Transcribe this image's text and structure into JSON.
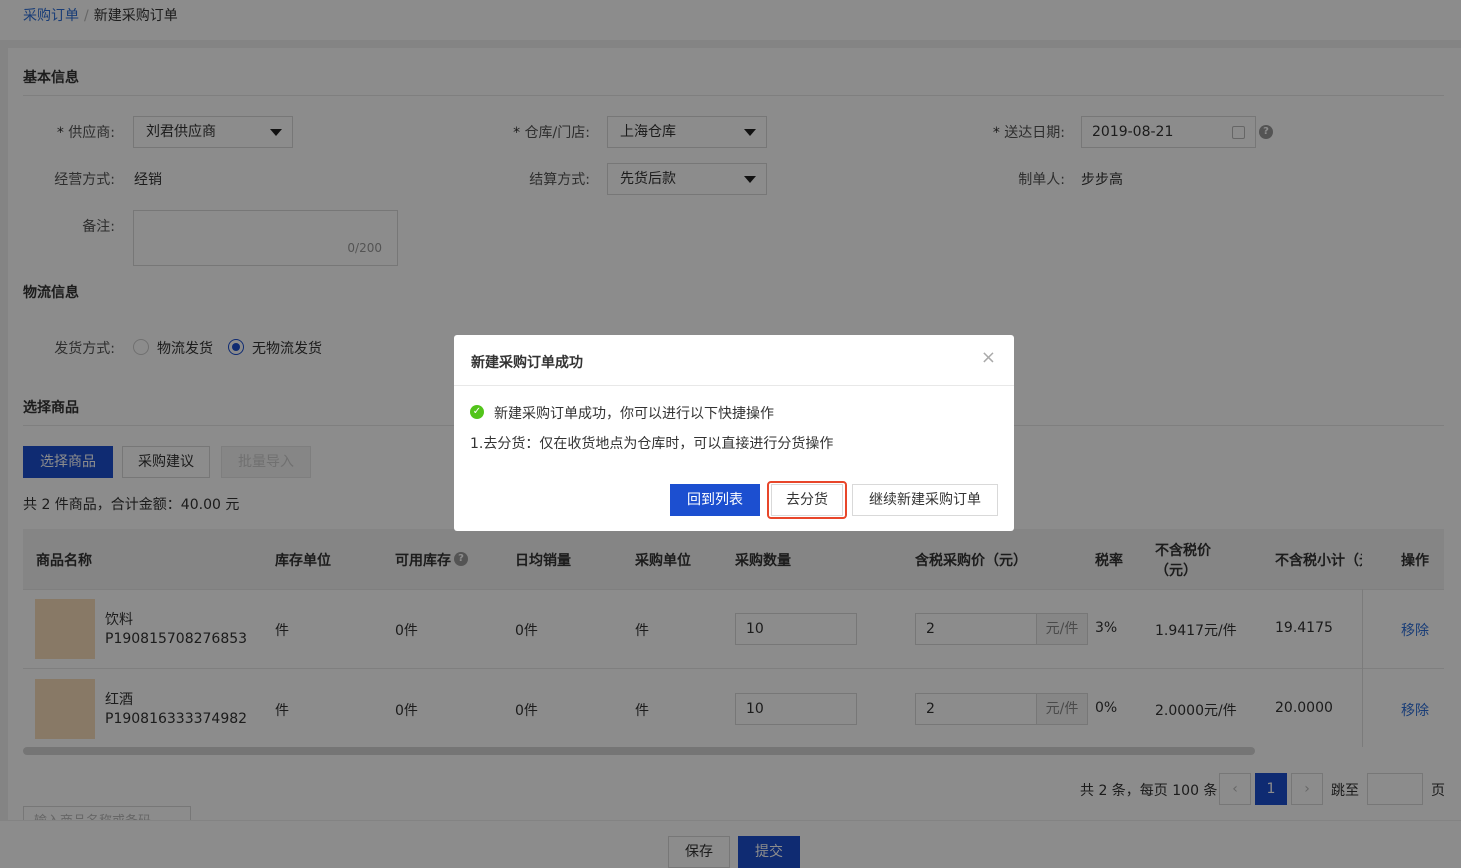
{
  "breadcrumb": {
    "parent": "采购订单",
    "sep": "/",
    "current": "新建采购订单"
  },
  "basic": {
    "title": "基本信息",
    "supplier_label": "供应商:",
    "supplier_value": "刘君供应商",
    "warehouse_label": "仓库/门店:",
    "warehouse_value": "上海仓库",
    "date_label": "送达日期:",
    "date_value": "2019-08-21",
    "business_label": "经营方式:",
    "business_value": "经销",
    "settle_label": "结算方式:",
    "settle_value": "先货后款",
    "maker_label": "制单人:",
    "maker_value": "步步高",
    "remark_label": "备注:",
    "remark_counter": "0/200"
  },
  "logistics": {
    "title": "物流信息",
    "ship_label": "发货方式:",
    "option1": "物流发货",
    "option2": "无物流发货",
    "selected": "无物流发货"
  },
  "goods": {
    "title": "选择商品",
    "btn_select": "选择商品",
    "btn_suggest": "采购建议",
    "btn_import": "批量导入",
    "summary": "共 2 件商品，合计金额：40.00 元",
    "columns": [
      "商品名称",
      "库存单位",
      "可用库存",
      "日均销量",
      "采购单位",
      "采购数量",
      "含税采购价（元）",
      "税率",
      "不含税价",
      "（元）",
      "不含税小计（元",
      "操作"
    ],
    "rows": [
      {
        "name": "饮料",
        "code": "P190815708276853",
        "stock_unit": "件",
        "available": "0件",
        "daily": "0件",
        "purchase_unit": "件",
        "qty": "10",
        "price": "2",
        "price_unit": "元/件",
        "tax": "3%",
        "net_price": "1.9417元/件",
        "subtotal": "19.4175",
        "action": "移除"
      },
      {
        "name": "红酒",
        "code": "P190816333374982",
        "stock_unit": "件",
        "available": "0件",
        "daily": "0件",
        "purchase_unit": "件",
        "qty": "10",
        "price": "2",
        "price_unit": "元/件",
        "tax": "0%",
        "net_price": "2.0000元/件",
        "subtotal": "20.0000",
        "action": "移除"
      }
    ]
  },
  "pagination": {
    "info": "共 2 条，每页 100 条",
    "current_page": "1",
    "jump_label": "跳至",
    "page_suffix": "页",
    "prev": "‹",
    "next": "›"
  },
  "search_placeholder": "输入商品名称或条码",
  "footer": {
    "save": "保存",
    "submit": "提交"
  },
  "modal": {
    "title": "新建采购订单成功",
    "close": "×",
    "message": "新建采购订单成功，你可以进行以下快捷操作",
    "tip": "1.去分货：仅在收货地点为仓库时，可以直接进行分货操作",
    "btn_back": "回到列表",
    "btn_distribute": "去分货",
    "btn_continue": "继续新建采购订单"
  },
  "colors": {
    "primary": "#1c4fd0",
    "link": "#2e6fd9",
    "success": "#52c41a",
    "highlight": "#e8462a"
  },
  "icons": {
    "help": "?",
    "check": "✓",
    "calendar": "calendar-icon"
  }
}
